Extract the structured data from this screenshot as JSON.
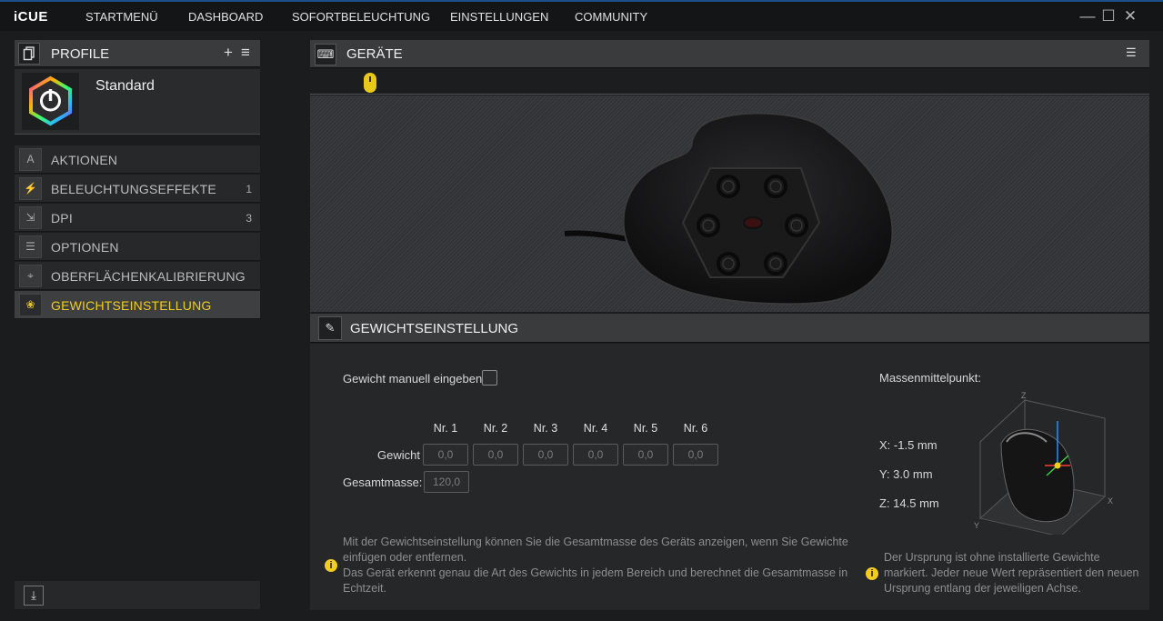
{
  "app": {
    "logo": "iCUE"
  },
  "nav": [
    "STARTMENÜ",
    "DASHBOARD",
    "SOFORTBELEUCHTUNG",
    "EINSTELLUNGEN",
    "COMMUNITY"
  ],
  "window": {
    "minimize": "—",
    "maximize": "☐",
    "close": "✕"
  },
  "profiles": {
    "title": "PROFILE",
    "add": "+",
    "menu": "≡",
    "current": "Standard"
  },
  "menu": [
    {
      "label": "AKTIONEN",
      "count": "",
      "icon": "A"
    },
    {
      "label": "BELEUCHTUNGSEFFEKTE",
      "count": "1",
      "icon": "⚡"
    },
    {
      "label": "DPI",
      "count": "3",
      "icon": "⇲"
    },
    {
      "label": "OPTIONEN",
      "count": "",
      "icon": "☰"
    },
    {
      "label": "OBERFLÄCHENKALIBRIERUNG",
      "count": "",
      "icon": "⌖"
    },
    {
      "label": "GEWICHTSEINSTELLUNG",
      "count": "",
      "icon": "❀"
    }
  ],
  "devices": {
    "title": "GERÄTE",
    "icon": "⌨",
    "filter": "☰"
  },
  "weight": {
    "title": "GEWICHTSEINSTELLUNG",
    "icon": "✎",
    "manual_label": "Gewicht manuell eingeben",
    "columns": [
      "Nr. 1",
      "Nr. 2",
      "Nr. 3",
      "Nr. 4",
      "Nr. 5",
      "Nr. 6"
    ],
    "row_label": "Gewicht",
    "values": [
      "0,0",
      "0,0",
      "0,0",
      "0,0",
      "0,0",
      "0,0"
    ],
    "total_label": "Gesamtmasse:",
    "total_value": "120,0",
    "info1_line1": "Mit der Gewichtseinstellung können Sie die Gesamtmasse des Geräts anzeigen, wenn Sie Gewichte",
    "info1_line2": "einfügen oder entfernen.",
    "info1_line3": "Das Gerät erkennt genau die Art des Gewichts in jedem Bereich und berechnet die Gesamtmasse in",
    "info1_line4": "Echtzeit.",
    "com_title": "Massenmittelpunkt:",
    "com_x": "X:  -1.5 mm",
    "com_y": "Y:    3.0 mm",
    "com_z": "Z:  14.5 mm",
    "axis_x": "X",
    "axis_y": "Y",
    "axis_z": "Z",
    "info2_line1": "Der Ursprung ist ohne installierte Gewichte",
    "info2_line2": "markiert. Jeder neue Wert repräsentiert den neuen",
    "info2_line3": "Ursprung entlang der jeweiligen Achse.",
    "info_glyph": "i"
  },
  "colors": {
    "accent": "#f2cd1e",
    "titlebar_border": "#1c4f8a"
  }
}
